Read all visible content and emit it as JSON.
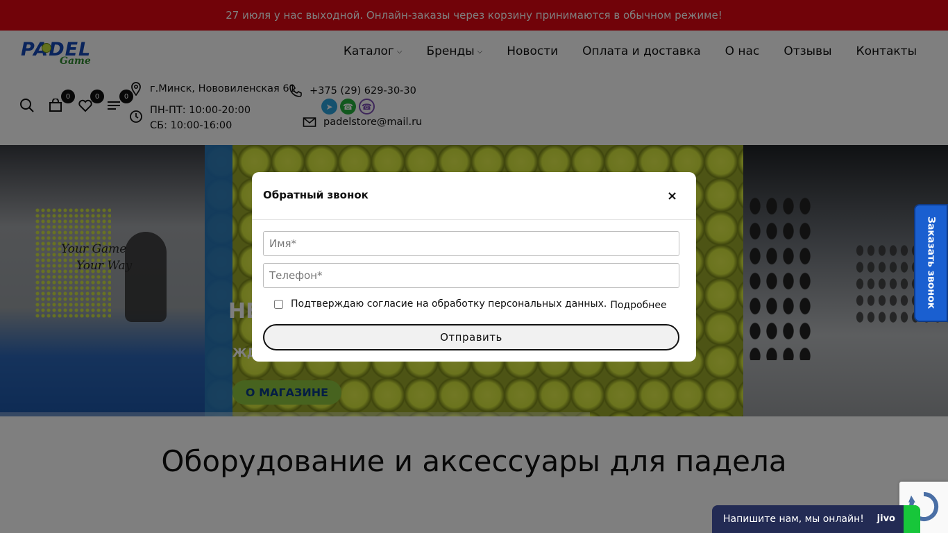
{
  "announcement": "27 июля у нас выходной. Онлайн-заказы через корзину принимаются в обычном режиме!",
  "logo": {
    "main": "PADEL",
    "sub": "Game"
  },
  "nav": [
    {
      "label": "Каталог",
      "dropdown": true
    },
    {
      "label": "Бренды",
      "dropdown": true
    },
    {
      "label": "Новости",
      "dropdown": false
    },
    {
      "label": "Оплата и доставка",
      "dropdown": false
    },
    {
      "label": "О нас",
      "dropdown": false
    },
    {
      "label": "Отзывы",
      "dropdown": false
    },
    {
      "label": "Контакты",
      "dropdown": false
    }
  ],
  "tools": {
    "cart_count": "0",
    "wishlist_count": "0",
    "compare_count": "0"
  },
  "contacts": {
    "address": "г.Минск, Нововиленская 61",
    "hours_weekdays": "ПН-ПТ: 10:00-20:00",
    "hours_saturday": "СБ: 10:00-16:00",
    "phone": "+375 (29) 629-30-30",
    "email": "padelstore@mail.ru"
  },
  "hero": {
    "slogan_line1": "Your Game",
    "slogan_line2": "Your Way",
    "title": "НЕ",
    "subtitle": "ЖД",
    "button": "О МАГАЗИНЕ"
  },
  "section_title": "Оборудование и аксессуары для падела",
  "side_tab": "Заказать звонок",
  "modal": {
    "title": "Обратный звонок",
    "close": "×",
    "name_placeholder": "Имя*",
    "phone_placeholder": "Телефон*",
    "consent": "Подтверждаю согласие на обработку персональных данных.",
    "consent_more": "Подробнее",
    "submit": "Отправить"
  },
  "chat": {
    "label": "Напишите нам, мы онлайн!",
    "brand": "jivo"
  },
  "colors": {
    "topbar": "#e30613",
    "brand_blue": "#1549b8",
    "hero_button": "#8ec63f",
    "chat": "#232b54"
  }
}
